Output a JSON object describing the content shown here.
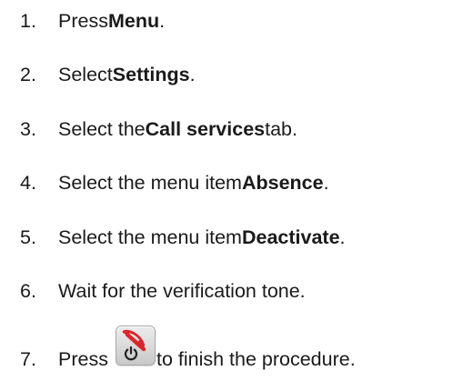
{
  "steps": [
    {
      "number": "1.",
      "before": "Press ",
      "bold": "Menu",
      "after": "."
    },
    {
      "number": "2.",
      "before": "Select ",
      "bold": "Settings",
      "after": "."
    },
    {
      "number": "3.",
      "before": "Select the ",
      "bold": "Call services",
      "after": " tab."
    },
    {
      "number": "4.",
      "before": "Select the menu item ",
      "bold": "Absence",
      "after": "."
    },
    {
      "number": "5.",
      "before": "Select the menu item ",
      "bold": "Deactivate",
      "after": "."
    },
    {
      "number": "6.",
      "before": "Wait for the verification tone.",
      "bold": "",
      "after": ""
    },
    {
      "number": "7.",
      "before": "Press ",
      "icon": "end-call-power-key-icon",
      "after": "to finish the procedure."
    }
  ],
  "colors": {
    "text": "#1a1a1a",
    "icon_red": "#d9262b",
    "icon_key_bg": "#dcdcdc"
  }
}
